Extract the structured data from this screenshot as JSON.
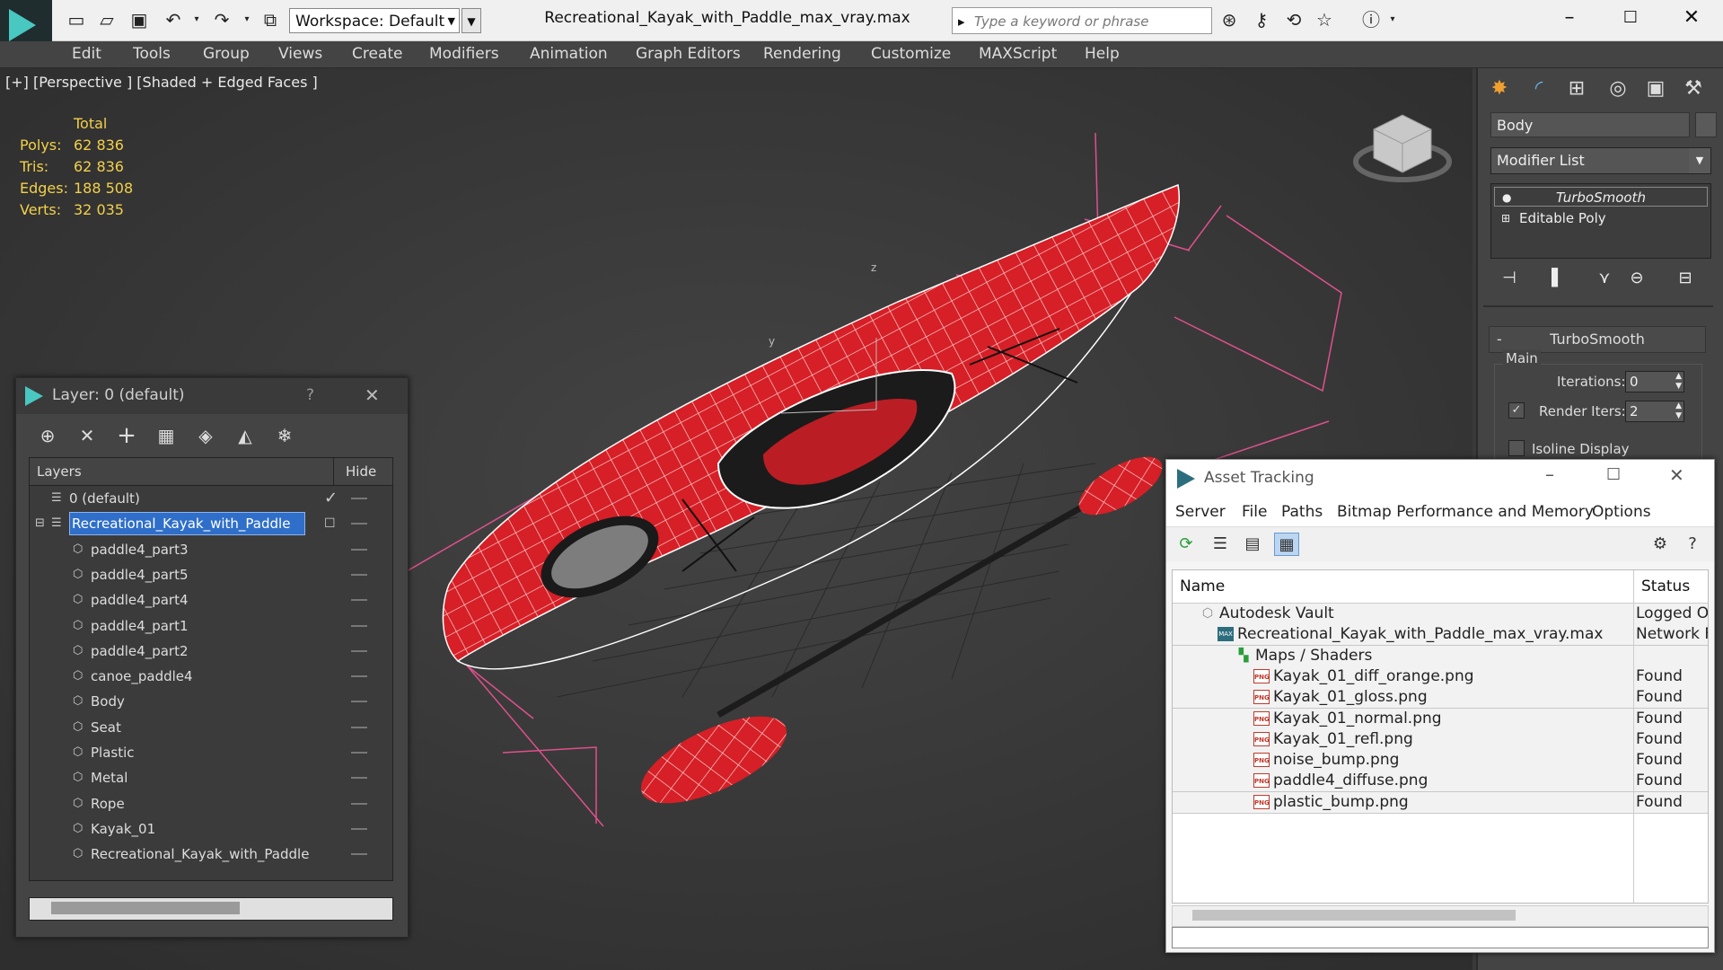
{
  "title_bar": {
    "workspace_label": "Workspace: Default",
    "document_title": "Recreational_Kayak_with_Paddle_max_vray.max",
    "search_placeholder": "Type a keyword or phrase"
  },
  "menu": [
    "Edit",
    "Tools",
    "Group",
    "Views",
    "Create",
    "Modifiers",
    "Animation",
    "Graph Editors",
    "Rendering",
    "Customize",
    "MAXScript",
    "Help"
  ],
  "viewport": {
    "label": "[+] [Perspective ] [Shaded + Edged Faces ]",
    "stats_header": "Total",
    "stats": [
      {
        "label": "Polys:",
        "value": "62 836"
      },
      {
        "label": "Tris:",
        "value": "62 836"
      },
      {
        "label": "Edges:",
        "value": "188 508"
      },
      {
        "label": "Verts:",
        "value": "32 035"
      }
    ],
    "axis_z": "z",
    "axis_y": "y"
  },
  "command_panel": {
    "object_name": "Body",
    "modifier_list": "Modifier List",
    "stack": [
      "TurboSmooth",
      "Editable Poly"
    ],
    "rollout_title": "TurboSmooth",
    "rollout_minus": "-",
    "group_main": "Main",
    "iterations_label": "Iterations:",
    "iterations_value": "0",
    "render_iters_label": "Render Iters:",
    "render_iters_value": "2",
    "isoline_label": "Isoline Display"
  },
  "layer_dialog": {
    "title": "Layer: 0 (default)",
    "help": "?",
    "col_layers": "Layers",
    "col_hide": "Hide",
    "rows": [
      {
        "name": "0 (default)",
        "level": 0,
        "kind": "layer"
      },
      {
        "name": "Recreational_Kayak_with_Paddle",
        "level": 0,
        "kind": "layer",
        "selected": true
      },
      {
        "name": "paddle4_part3",
        "level": 1,
        "kind": "object"
      },
      {
        "name": "paddle4_part5",
        "level": 1,
        "kind": "object"
      },
      {
        "name": "paddle4_part4",
        "level": 1,
        "kind": "object"
      },
      {
        "name": "paddle4_part1",
        "level": 1,
        "kind": "object"
      },
      {
        "name": "paddle4_part2",
        "level": 1,
        "kind": "object"
      },
      {
        "name": "canoe_paddle4",
        "level": 1,
        "kind": "object"
      },
      {
        "name": "Body",
        "level": 1,
        "kind": "object"
      },
      {
        "name": "Seat",
        "level": 1,
        "kind": "object"
      },
      {
        "name": "Plastic",
        "level": 1,
        "kind": "object"
      },
      {
        "name": "Metal",
        "level": 1,
        "kind": "object"
      },
      {
        "name": "Rope",
        "level": 1,
        "kind": "object"
      },
      {
        "name": "Kayak_01",
        "level": 1,
        "kind": "object"
      },
      {
        "name": "Recreational_Kayak_with_Paddle",
        "level": 1,
        "kind": "object"
      }
    ]
  },
  "asset_dialog": {
    "title": "Asset Tracking",
    "menu": [
      "Server",
      "File",
      "Paths",
      "Bitmap Performance and Memory",
      "Options"
    ],
    "col_name": "Name",
    "col_status": "Status",
    "rows": [
      {
        "name": "Autodesk Vault",
        "status": "Logged O",
        "level": 0,
        "icon": "vault"
      },
      {
        "name": "Recreational_Kayak_with_Paddle_max_vray.max",
        "status": "Network F",
        "level": 1,
        "icon": "max"
      },
      {
        "name": "Maps / Shaders",
        "status": "",
        "level": 2,
        "icon": "maps"
      },
      {
        "name": "Kayak_01_diff_orange.png",
        "status": "Found",
        "level": 3,
        "icon": "png"
      },
      {
        "name": "Kayak_01_gloss.png",
        "status": "Found",
        "level": 3,
        "icon": "png"
      },
      {
        "name": "Kayak_01_normal.png",
        "status": "Found",
        "level": 3,
        "icon": "png"
      },
      {
        "name": "Kayak_01_refl.png",
        "status": "Found",
        "level": 3,
        "icon": "png"
      },
      {
        "name": "noise_bump.png",
        "status": "Found",
        "level": 3,
        "icon": "png"
      },
      {
        "name": "paddle4_diffuse.png",
        "status": "Found",
        "level": 3,
        "icon": "png"
      },
      {
        "name": "plastic_bump.png",
        "status": "Found",
        "level": 3,
        "icon": "png"
      }
    ]
  },
  "icons": {
    "png_badge": "PNG",
    "max_badge": "MAX"
  },
  "colors": {
    "kayak_red": "#d61f26",
    "stats_yellow": "#f2d04a",
    "selection_blue": "#2f6fc9",
    "bbox_pink": "#e0508c"
  }
}
